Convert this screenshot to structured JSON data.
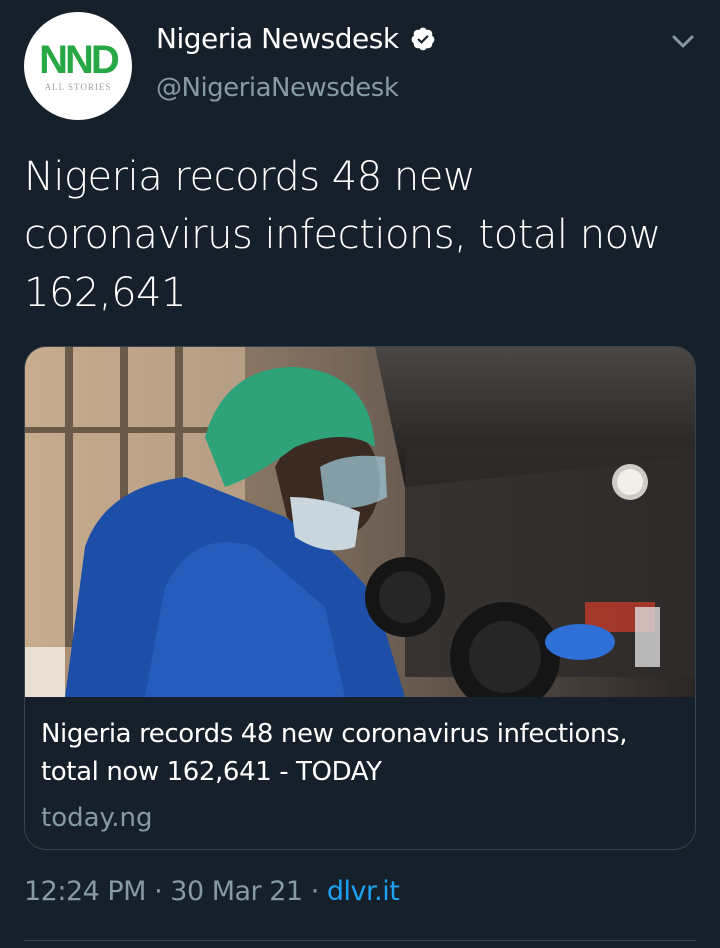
{
  "account": {
    "display_name": "Nigeria Newsdesk",
    "handle": "@NigeriaNewsdesk",
    "avatar_logo": "NND",
    "avatar_subtext": "ALL STORIES",
    "verified_icon": "verified-badge-icon",
    "menu_icon": "chevron-down-icon"
  },
  "tweet": {
    "text": "Nigeria records 48 new coronavirus infections, total now 162,641"
  },
  "card": {
    "title": "Nigeria records 48 new coronavirus infections, total now 162,641 - TODAY",
    "domain": "today.ng"
  },
  "meta": {
    "time": "12:24 PM",
    "date": "30 Mar 21",
    "separator": "·",
    "source": "dlvr.it"
  },
  "colors": {
    "background": "#15202b",
    "secondary_text": "#8899a6",
    "link": "#1da1f2",
    "border": "#38444d",
    "avatar_logo": "#27a844"
  }
}
